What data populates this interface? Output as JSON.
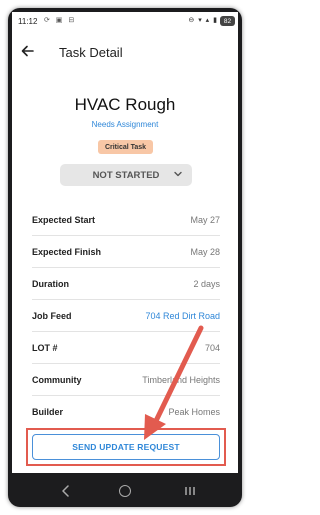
{
  "status_bar": {
    "time": "11:12",
    "left_icons": "⟳ ▣ ⊟",
    "right_icons": "⊖ ▾ ▴ ▮",
    "battery": "82"
  },
  "header": {
    "title": "Task Detail",
    "back_icon": "arrow-left-icon"
  },
  "task": {
    "title": "HVAC Rough",
    "assignment_link": "Needs Assignment",
    "critical_badge": "Critical Task",
    "status": "NOT STARTED"
  },
  "details": [
    {
      "label": "Expected Start",
      "value": "May 27",
      "link": false
    },
    {
      "label": "Expected Finish",
      "value": "May 28",
      "link": false
    },
    {
      "label": "Duration",
      "value": "2 days",
      "link": false
    },
    {
      "label": "Job Feed",
      "value": "704 Red Dirt Road",
      "link": true
    },
    {
      "label": "LOT #",
      "value": "704",
      "link": false
    },
    {
      "label": "Community",
      "value": "Timberland Heights",
      "link": false
    },
    {
      "label": "Builder",
      "value": "Peak Homes",
      "link": false
    }
  ],
  "send_button": "SEND UPDATE REQUEST",
  "colors": {
    "accent": "#2f87d8",
    "critical": "#f8c7a6",
    "annotation": "#e25b4f"
  }
}
